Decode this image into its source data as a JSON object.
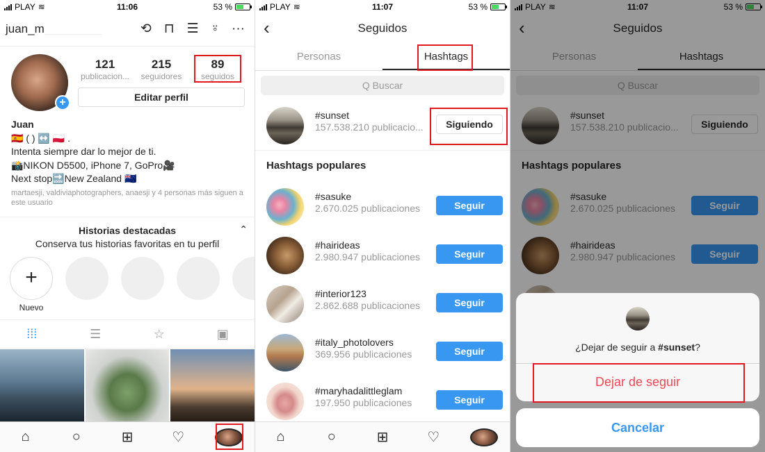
{
  "status_bar": {
    "p1": {
      "carrier": "PLAY",
      "time": "11:06",
      "battery": "53 %"
    },
    "p2": {
      "carrier": "PLAY",
      "time": "11:07",
      "battery": "53 %"
    },
    "p3": {
      "carrier": "PLAY",
      "time": "11:07",
      "battery": "53 %"
    }
  },
  "profile": {
    "username": "juan_m",
    "stats": [
      {
        "num": "121",
        "label": "publicacion..."
      },
      {
        "num": "215",
        "label": "seguidores"
      },
      {
        "num": "89",
        "label": "seguidos"
      }
    ],
    "edit_label": "Editar perfil",
    "name": "Juan",
    "bio_line1": "🇪🇸 (   ) ↔️   🇵🇱 .",
    "bio_line2": "Intenta siempre dar lo mejor de ti.",
    "bio_line3": "📸NIKON D5500, iPhone 7, GoPro🎥",
    "bio_line4": "Next stop🔜New Zealand 🇳🇿",
    "followed_by": "martaesji, valdiviaphotographers, anaesji y 4 personas más siguen a este usuario",
    "highlights_title": "Historias destacadas",
    "highlights_sub": "Conserva tus historias favoritas en tu perfil",
    "new_label": "Nuevo"
  },
  "following": {
    "title": "Seguidos",
    "tabs": [
      "Personas",
      "Hashtags"
    ],
    "search_placeholder": "Q Buscar",
    "followed_tag": {
      "name": "#sunset",
      "count": "157.538.210 publicacio...",
      "button": "Siguiendo"
    },
    "popular_title": "Hashtags populares",
    "popular": [
      {
        "name": "#sasuke",
        "count": "2.670.025 publicaciones",
        "button": "Seguir"
      },
      {
        "name": "#hairideas",
        "count": "2.980.947 publicaciones",
        "button": "Seguir"
      },
      {
        "name": "#interior123",
        "count": "2.862.688 publicaciones",
        "button": "Seguir"
      },
      {
        "name": "#italy_photolovers",
        "count": "369.956 publicaciones",
        "button": "Seguir"
      },
      {
        "name": "#maryhadalittleglam",
        "count": "197.950 publicaciones",
        "button": "Seguir"
      }
    ]
  },
  "dialog": {
    "message_prefix": "¿Dejar de seguir a ",
    "message_tag": "#sunset",
    "message_suffix": "?",
    "unfollow": "Dejar de seguir",
    "cancel": "Cancelar"
  },
  "colors": {
    "accent": "#3897f0",
    "highlight_box": "#e0181f",
    "destructive": "#ed4956"
  }
}
